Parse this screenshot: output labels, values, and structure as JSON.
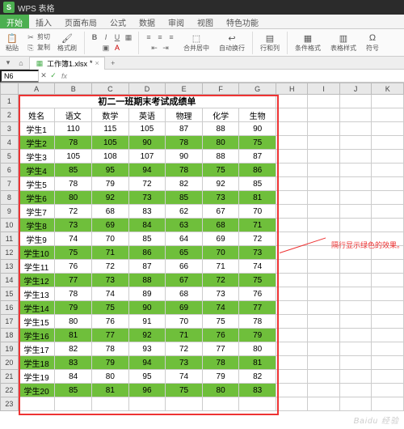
{
  "app": {
    "badge": "S",
    "title": "WPS 表格"
  },
  "menu": {
    "tabs": [
      "开始",
      "插入",
      "页面布局",
      "公式",
      "数据",
      "审阅",
      "视图",
      "特色功能"
    ],
    "active": 0
  },
  "ribbon": {
    "paste": "粘贴",
    "cut": "剪切",
    "copy": "复制",
    "format_painter": "格式刷",
    "merge": "合并居中",
    "wrap": "自动换行",
    "row_col": "行和列",
    "cond_format": "条件格式",
    "table_style": "表格样式",
    "symbol": "符号"
  },
  "doc": {
    "name": "工作簿1.xlsx",
    "dirty": "*"
  },
  "formula": {
    "cell_ref": "N6",
    "fx": "fx",
    "value": ""
  },
  "cols": [
    "A",
    "B",
    "C",
    "D",
    "E",
    "F",
    "G",
    "H",
    "I",
    "J",
    "K"
  ],
  "title_text": "初二一班期末考试成绩单",
  "headers": [
    "姓名",
    "语文",
    "数学",
    "英语",
    "物理",
    "化学",
    "生物"
  ],
  "rows": [
    {
      "n": "学生1",
      "v": [
        110,
        115,
        105,
        87,
        88,
        90
      ]
    },
    {
      "n": "学生2",
      "v": [
        78,
        105,
        90,
        78,
        80,
        75
      ]
    },
    {
      "n": "学生3",
      "v": [
        105,
        108,
        107,
        90,
        88,
        87
      ]
    },
    {
      "n": "学生4",
      "v": [
        85,
        95,
        94,
        78,
        75,
        86
      ]
    },
    {
      "n": "学生5",
      "v": [
        78,
        79,
        72,
        82,
        92,
        85
      ]
    },
    {
      "n": "学生6",
      "v": [
        80,
        92,
        73,
        85,
        73,
        81
      ]
    },
    {
      "n": "学生7",
      "v": [
        72,
        68,
        83,
        62,
        67,
        70
      ]
    },
    {
      "n": "学生8",
      "v": [
        73,
        69,
        84,
        63,
        68,
        71
      ]
    },
    {
      "n": "学生9",
      "v": [
        74,
        70,
        85,
        64,
        69,
        72
      ]
    },
    {
      "n": "学生10",
      "v": [
        75,
        71,
        86,
        65,
        70,
        73
      ]
    },
    {
      "n": "学生11",
      "v": [
        76,
        72,
        87,
        66,
        71,
        74
      ]
    },
    {
      "n": "学生12",
      "v": [
        77,
        73,
        88,
        67,
        72,
        75
      ]
    },
    {
      "n": "学生13",
      "v": [
        78,
        74,
        89,
        68,
        73,
        76
      ]
    },
    {
      "n": "学生14",
      "v": [
        79,
        75,
        90,
        69,
        74,
        77
      ]
    },
    {
      "n": "学生15",
      "v": [
        80,
        76,
        91,
        70,
        75,
        78
      ]
    },
    {
      "n": "学生16",
      "v": [
        81,
        77,
        92,
        71,
        76,
        79
      ]
    },
    {
      "n": "学生17",
      "v": [
        82,
        78,
        93,
        72,
        77,
        80
      ]
    },
    {
      "n": "学生18",
      "v": [
        83,
        79,
        94,
        73,
        78,
        81
      ]
    },
    {
      "n": "学生19",
      "v": [
        84,
        80,
        95,
        74,
        79,
        82
      ]
    },
    {
      "n": "学生20",
      "v": [
        85,
        81,
        96,
        75,
        80,
        83
      ]
    }
  ],
  "annotation": "隔行显示绿色的效果。",
  "watermark": "Baidu 经验"
}
